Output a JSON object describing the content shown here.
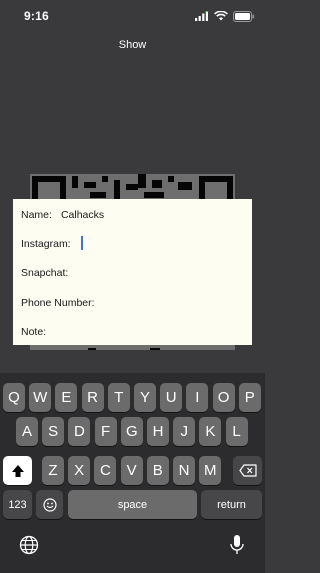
{
  "status": {
    "time": "9:16"
  },
  "nav": {
    "title": "Show"
  },
  "form": {
    "name_label": "Name:",
    "name_value": "Calhacks",
    "instagram_label": "Instagram:",
    "instagram_value": "",
    "snapchat_label": "Snapchat:",
    "phone_label": "Phone Number:",
    "note_label": "Note:"
  },
  "keyboard": {
    "row1": [
      "Q",
      "W",
      "E",
      "R",
      "T",
      "Y",
      "U",
      "I",
      "O",
      "P"
    ],
    "row2": [
      "A",
      "S",
      "D",
      "F",
      "G",
      "H",
      "J",
      "K",
      "L"
    ],
    "row3": [
      "Z",
      "X",
      "C",
      "V",
      "B",
      "N",
      "M"
    ],
    "numbers_label": "123",
    "space_label": "space",
    "return_label": "return"
  },
  "icons": [
    "shift-icon",
    "backspace-icon",
    "emoji-icon",
    "globe-icon",
    "microphone-icon",
    "signal-icon",
    "wifi-icon",
    "battery-icon"
  ],
  "colors": {
    "background": "#3a3a3c",
    "card": "#fdfdf1",
    "caret": "#3f6df2",
    "key": "#6b6b6b"
  }
}
